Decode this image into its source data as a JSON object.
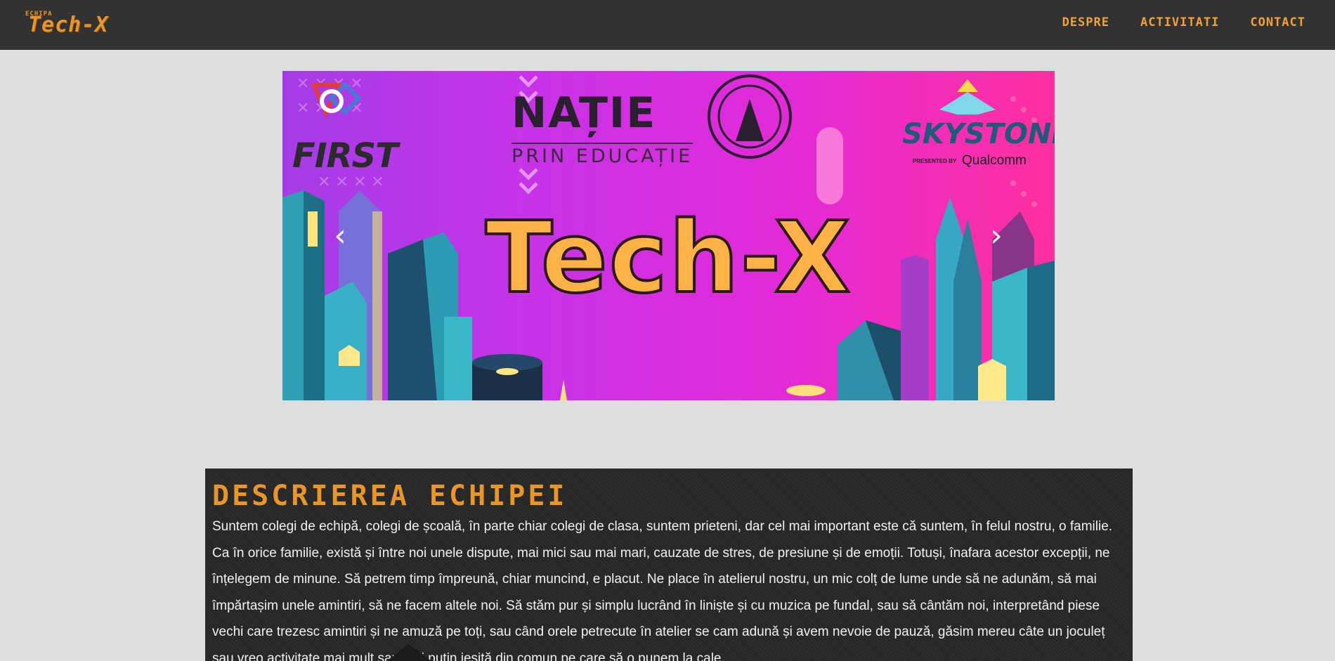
{
  "navbar": {
    "logo_small": "ECHIPA",
    "logo_big": "Tech-X",
    "links": [
      "DESPRE",
      "ACTIVITATI",
      "CONTACT"
    ]
  },
  "carousel": {
    "title": "Tech-X",
    "logos": {
      "first": "FIRST",
      "natie": "NAȚIE",
      "natie_sub": "PRIN EDUCAȚIE",
      "skystone": "SKYSTONE",
      "presented_by": "PRESENTED BY",
      "qualcomm": "Qualcomm"
    },
    "prev_icon": "chevron-left",
    "next_icon": "chevron-right"
  },
  "description": {
    "heading": "DESCRIEREA ECHIPEI",
    "text": "Suntem colegi de echipă, colegi de școală, în parte chiar colegi de clasa, suntem prieteni, dar cel mai important este că suntem, în felul nostru, o familie. Ca în orice familie, există și între noi unele dispute, mai mici sau mai mari, cauzate de stres, de presiune și de emoții. Totuși, înafara acestor excepții, ne înțelegem de minune. Să petrem timp împreună, chiar muncind, e placut. Ne place în atelierul nostru, un mic colț de lume unde să ne adunăm, să mai împărtașim unele amintiri, să ne facem altele noi. Să stăm pur și simplu lucrând în liniște și cu muzica pe fundal, sau să cântăm noi, interpretând piese vechi care trezesc amintiri și ne amuză pe toți, sau când orele petrecute în atelier se cam adună și avem nevoie de pauză, găsim mereu câte un joculeț sau vreo activitate mai mult sau mai puțin ieșită din comun pe care să o punem la cale."
  },
  "colors": {
    "navbar_bg": "#323232",
    "accent": "#f0a23a",
    "page_bg": "#dedede",
    "section_bg": "#292929"
  }
}
